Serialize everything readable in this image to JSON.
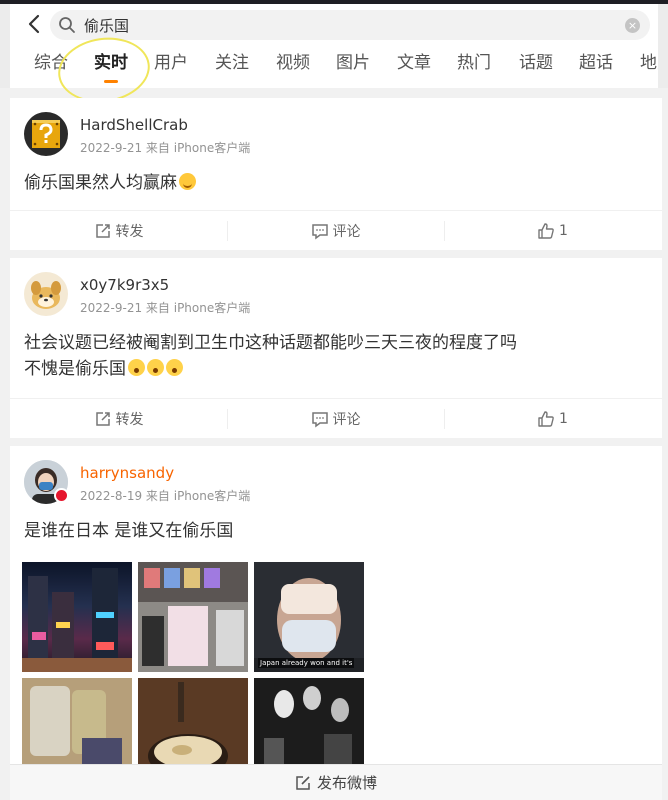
{
  "search": {
    "query": "偷乐国"
  },
  "tabs": [
    {
      "label": "综合"
    },
    {
      "label": "实时"
    },
    {
      "label": "用户"
    },
    {
      "label": "关注"
    },
    {
      "label": "视频"
    },
    {
      "label": "图片"
    },
    {
      "label": "文章"
    },
    {
      "label": "热门"
    },
    {
      "label": "话题"
    },
    {
      "label": "超话"
    },
    {
      "label": "地点"
    }
  ],
  "active_tab": "实时",
  "posts": [
    {
      "username": "HardShellCrab",
      "meta": "2022-9-21 来自 iPhone客户端",
      "text": "偷乐国果然人均赢麻",
      "emoji": [
        "smile-emoji"
      ],
      "repost_label": "转发",
      "comment_label": "评论",
      "like_count": "1"
    },
    {
      "username": "x0y7k9r3x5",
      "meta": "2022-9-21 来自 iPhone客户端",
      "text_line1": "社会议题已经被阉割到卫生巾这种话题都能吵三天三夜的程度了吗",
      "text_line2": "不愧是偷乐国",
      "emoji": [
        "scream-emoji",
        "scream-emoji",
        "scream-emoji"
      ],
      "repost_label": "转发",
      "comment_label": "评论",
      "like_count": "1"
    },
    {
      "username": "harrynsandy",
      "meta": "2022-8-19 来自 iPhone客户端",
      "text": "是谁在日本 是谁又在偷乐国",
      "photo_caption": "Japan already won and it's"
    }
  ],
  "footer": {
    "label": "发布微博"
  },
  "colors": {
    "accent": "#ff8200",
    "vip_name": "#f86400",
    "meta_text": "#939393"
  }
}
